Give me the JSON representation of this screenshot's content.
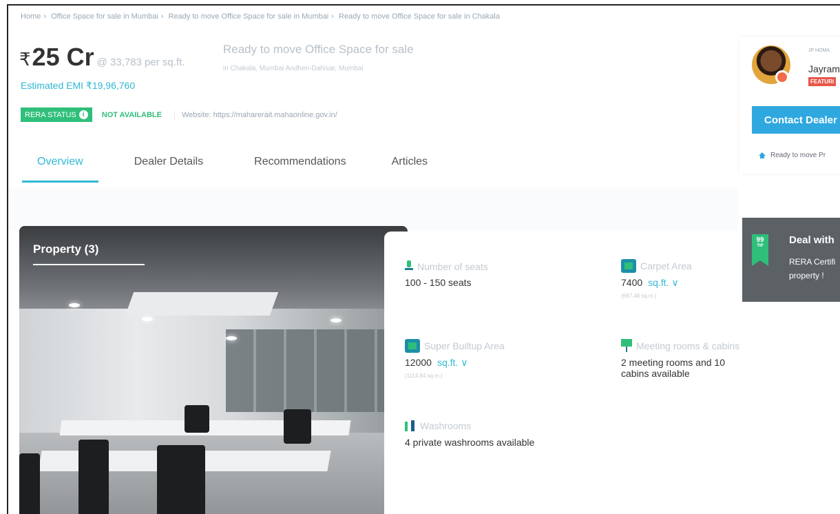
{
  "breadcrumb": {
    "items": [
      "Home",
      "Office Space for sale in Mumbai",
      "Ready to move Office Space for sale in Mumbai",
      "Ready to move Office Space for sale in Chakala"
    ],
    "sep": "›"
  },
  "listing": {
    "rupee": "₹",
    "price": "25 Cr",
    "per_sqft": "@ 33,783 per sq.ft.",
    "title": "Ready to move Office Space for sale",
    "location": "in Chakala, Mumbai Andheri-Dahisar, Mumbai",
    "emi": "Estimated EMI ₹19,96,760"
  },
  "rera": {
    "label": "RERA STATUS",
    "info_icon": "i",
    "status": "NOT AVAILABLE",
    "website": "Website: https://maharerait.mahaonline.gov.in/"
  },
  "tabs": [
    {
      "label": "Overview",
      "active": true
    },
    {
      "label": "Dealer Details"
    },
    {
      "label": "Recommendations"
    },
    {
      "label": "Articles"
    }
  ],
  "photo": {
    "title": "Property (3)"
  },
  "details": {
    "seats": {
      "label": "Number of seats",
      "value": "100 - 150 seats",
      "icon": "seat-icon"
    },
    "carpet": {
      "label": "Carpet Area",
      "value": "7400",
      "unit": "sq.ft.",
      "chevron": "∨",
      "sub": "(687.48 sq.m.)",
      "icon": "area-icon"
    },
    "super": {
      "label": "Super Builtup Area",
      "value": "12000",
      "unit": "sq.ft.",
      "chevron": "∨",
      "sub": "(1114.84 sq.m.)",
      "icon": "area-icon"
    },
    "meeting": {
      "label": "Meeting rooms & cabins",
      "value": "2 meeting rooms and 10 cabins available",
      "icon": "meeting-icon"
    },
    "washrooms": {
      "label": "Washrooms",
      "value": "4 private washrooms available",
      "icon": "washroom-icon"
    }
  },
  "dealer": {
    "tag": "JP HOMA",
    "name": "Jayram",
    "featured": "FEATURI",
    "contact_label": "Contact Dealer",
    "line": "Ready to move Pr"
  },
  "tip": {
    "badge_num": "99",
    "badge_sub": "TIP",
    "title": "Deal with",
    "text": "RERA Certifi property !"
  },
  "colors": {
    "accent": "#2fb9d4",
    "green": "#2fbf7a",
    "button": "#2fa8e0",
    "featured": "#e8564a"
  }
}
